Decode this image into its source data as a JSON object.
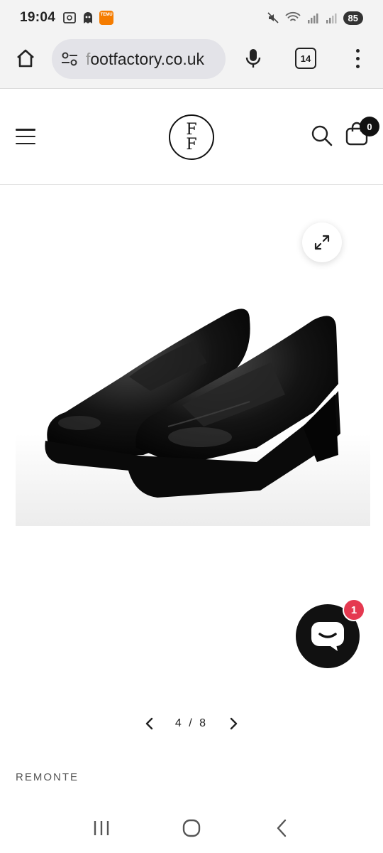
{
  "status_bar": {
    "time": "19:04",
    "temu_label": "TEMU",
    "battery": "85",
    "icons": [
      "screenshot-icon",
      "ghost-app-icon",
      "temu-app-icon",
      "mute-icon",
      "wifi-icon",
      "signal-icon-r",
      "signal-icon"
    ]
  },
  "browser": {
    "url_prefix": "f",
    "url": "ootfactory.co.uk",
    "tab_count": "14",
    "icons": [
      "home-icon",
      "site-settings-icon",
      "microphone-icon",
      "tabs-icon",
      "more-vert-icon"
    ]
  },
  "header": {
    "logo_top": "F",
    "logo_bottom": "F",
    "cart_count": "0",
    "icons": [
      "hamburger-icon",
      "search-icon",
      "shopping-bag-icon"
    ]
  },
  "gallery": {
    "current": "4",
    "separator": "/",
    "total": "8",
    "image_alt": "black patent leather penny loafers on chunky heel",
    "icons": [
      "expand-icon",
      "chevron-left-icon",
      "chevron-right-icon"
    ]
  },
  "chat": {
    "badge": "1",
    "icons": [
      "chat-bubble-icon"
    ]
  },
  "product": {
    "brand": "REMONTE"
  },
  "nav": {
    "icons": [
      "recents-icon",
      "home-circle-icon",
      "back-icon"
    ]
  },
  "colors": {
    "accent_badge": "#e53950",
    "dark": "#111111",
    "chrome_bg": "#f3f3f3"
  }
}
